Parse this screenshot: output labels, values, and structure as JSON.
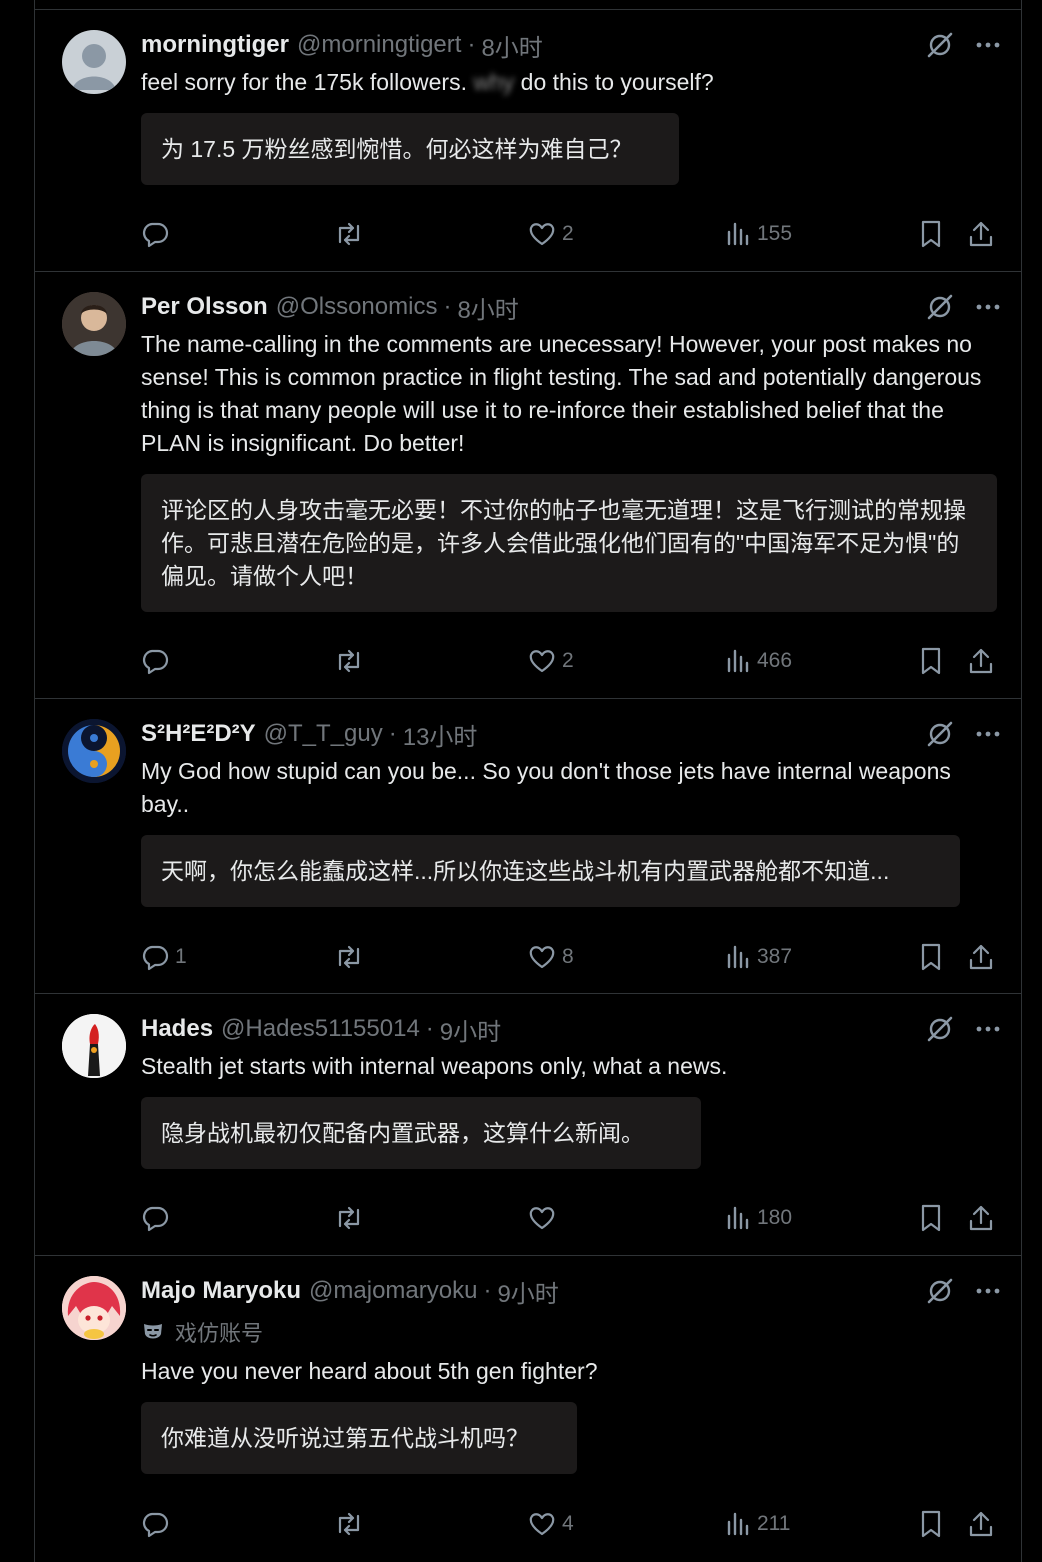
{
  "posts": [
    {
      "name": "morningtiger",
      "handle": "@morningtigert",
      "time": "8小时",
      "text_before": "feel sorry for the 175k followers.",
      "text_blur": "why",
      "text_after": "do this to yourself?",
      "translation": "为 17.5 万粉丝感到惋惜。何必这样为难自己？",
      "replies": "",
      "likes": "2",
      "views": "155"
    },
    {
      "name": "Per Olsson",
      "handle": "@Olssonomics",
      "time": "8小时",
      "text": "The name-calling in the comments are unecessary! However, your post makes no sense! This is common practice in flight testing. The sad and potentially dangerous thing is that many people will use it to re-inforce their established belief that the PLAN is insignificant. Do better!",
      "translation": "评论区的人身攻击毫无必要！不过你的帖子也毫无道理！这是飞行测试的常规操作。可悲且潜在危险的是，许多人会借此强化他们固有的\"中国海军不足为惧\"的偏见。请做个人吧！",
      "replies": "",
      "likes": "2",
      "views": "466"
    },
    {
      "name": "S²H²E²D²Y",
      "handle": "@T_T_guy",
      "time": "13小时",
      "text": "My God how stupid can you be... So you don't those jets have internal weapons bay..",
      "translation": "天啊，你怎么能蠢成这样...所以你连这些战斗机有内置武器舱都不知道...",
      "replies": "1",
      "likes": "8",
      "views": "387"
    },
    {
      "name": "Hades",
      "handle": "@Hades51155014",
      "time": "9小时",
      "text": "Stealth jet starts with internal weapons only, what a news.",
      "translation": "隐身战机最初仅配备内置武器，这算什么新闻。",
      "replies": "",
      "likes": "",
      "views": "180"
    },
    {
      "name": "Majo Maryoku",
      "handle": "@majomaryoku",
      "time": "9小时",
      "badge": "戏仿账号",
      "text": "Have you never heard about 5th gen fighter?",
      "translation": "你难道从没听说过第五代战斗机吗？",
      "replies": "",
      "likes": "4",
      "views": "211"
    }
  ],
  "icons": {
    "reply": "reply-icon",
    "repost": "repost-icon",
    "like": "heart-icon",
    "views": "views-icon",
    "bookmark": "bookmark-icon",
    "share": "share-icon",
    "grok": "grok-icon",
    "more": "more-icon"
  },
  "colors": {
    "background": "#000000",
    "text": "#e7e9ea",
    "muted": "#71767b",
    "border": "#2f3336",
    "translation_bg": "#1c1a1a"
  }
}
